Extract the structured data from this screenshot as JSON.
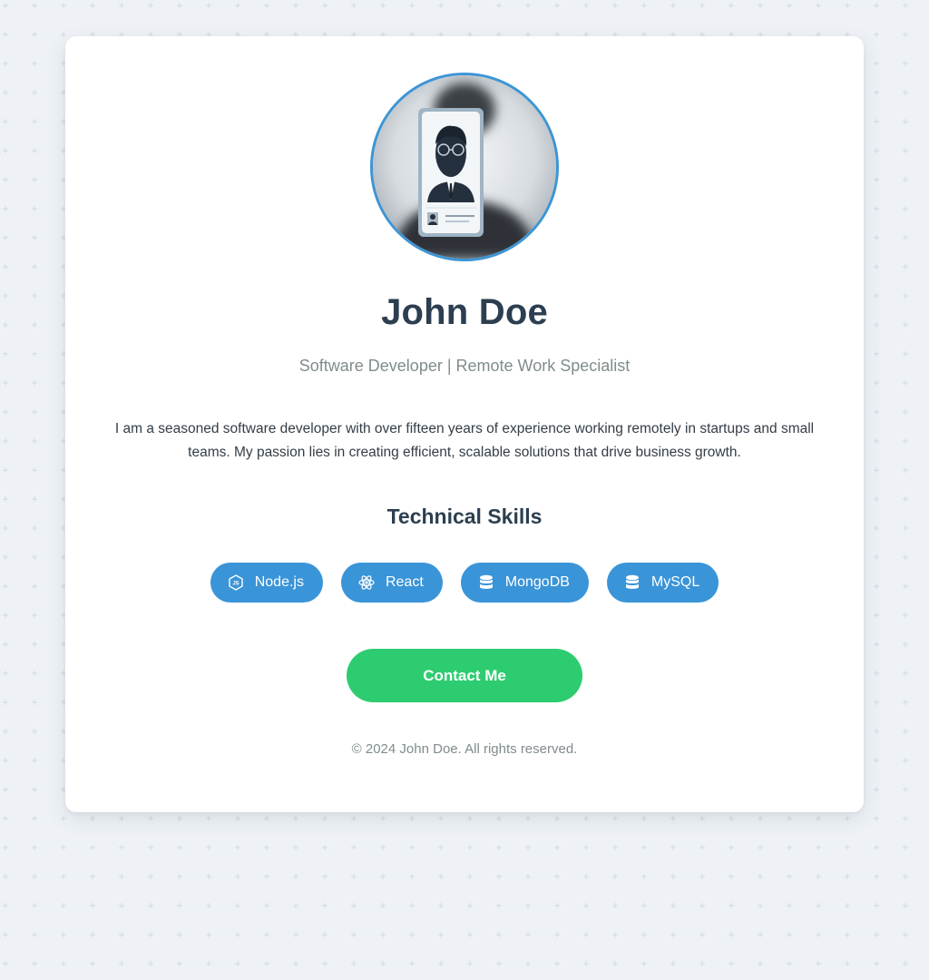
{
  "profile": {
    "name": "John Doe",
    "tagline": "Software Developer | Remote Work Specialist",
    "bio": "I am a seasoned software developer with over fifteen years of experience working remotely in startups and small teams. My passion lies in creating efficient, scalable solutions that drive business growth.",
    "avatar_icon": "person-id-badge-icon"
  },
  "skills": {
    "title": "Technical Skills",
    "items": [
      {
        "label": "Node.js",
        "icon": "nodejs-icon"
      },
      {
        "label": "React",
        "icon": "react-icon"
      },
      {
        "label": "MongoDB",
        "icon": "database-icon"
      },
      {
        "label": "MySQL",
        "icon": "database-icon"
      }
    ]
  },
  "contact": {
    "label": "Contact Me"
  },
  "footer": {
    "text": "© 2024 John Doe. All rights reserved."
  },
  "colors": {
    "background": "#eef2f6",
    "card": "#ffffff",
    "heading": "#2c3e50",
    "muted": "#7f8c8d",
    "skill_pill": "#3a94d8",
    "contact_button": "#2ecc71",
    "avatar_border": "#3d95d5"
  }
}
